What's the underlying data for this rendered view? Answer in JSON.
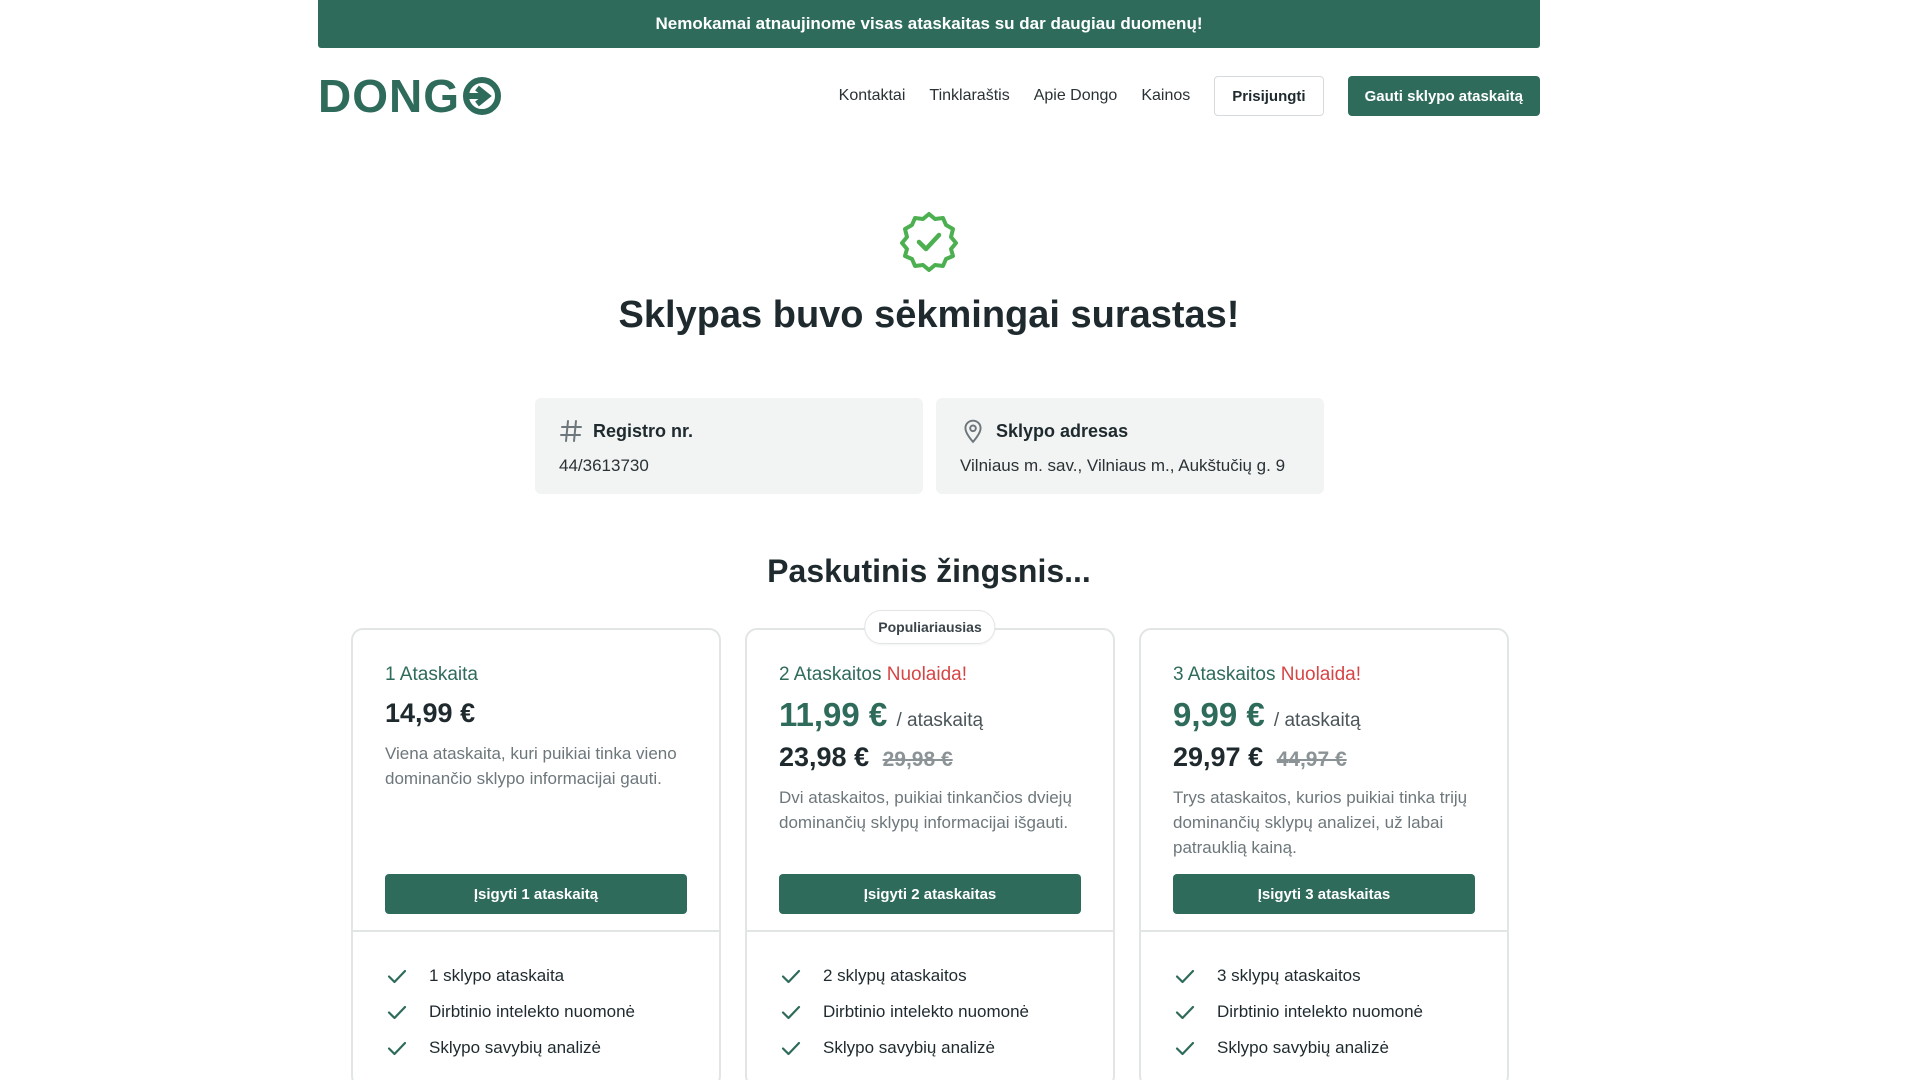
{
  "banner": {
    "text": "Nemokamai atnaujinome visas ataskaitas su dar daugiau duomenų!"
  },
  "header": {
    "logo_text": "DONG",
    "nav": [
      "Kontaktai",
      "Tinklaraštis",
      "Apie Dongo",
      "Kainos"
    ],
    "login_label": "Prisijungti",
    "cta_label": "Gauti sklypo ataskaitą"
  },
  "result": {
    "title": "Sklypas buvo sėkmingai surastas!",
    "registry": {
      "label": "Registro nr.",
      "value": "44/3613730"
    },
    "address": {
      "label": "Sklypo adresas",
      "value": "Vilniaus m. sav., Vilniaus m., Aukštučių g. 9"
    }
  },
  "pricing": {
    "title": "Paskutinis žingsnis...",
    "popular_badge": "Populiariausias",
    "plans": [
      {
        "name": "1 Ataskaita",
        "promo": "",
        "price": "14,99 €",
        "description": "Viena ataskaita, kuri puikiai tinka vieno dominančio sklypo informacijai gauti.",
        "button": "Įsigyti 1 ataskaitą",
        "features": [
          "1 sklypo ataskaita",
          "Dirbtinio intelekto nuomonė",
          "Sklypo savybių analizė"
        ]
      },
      {
        "name": "2 Ataskaitos",
        "promo": "Nuolaida!",
        "unit_price": "11,99 €",
        "per": "/ ataskaitą",
        "total": "23,98 €",
        "old_total": "29,98 €",
        "description": "Dvi ataskaitos, puikiai tinkančios dviejų dominančių sklypų informacijai išgauti.",
        "button": "Įsigyti 2 ataskaitas",
        "features": [
          "2 sklypų ataskaitos",
          "Dirbtinio intelekto nuomonė",
          "Sklypo savybių analizė"
        ]
      },
      {
        "name": "3 Ataskaitos",
        "promo": "Nuolaida!",
        "unit_price": "9,99 €",
        "per": "/ ataskaitą",
        "total": "29,97 €",
        "old_total": "44,97 €",
        "description": "Trys ataskaitos, kurios puikiai tinka trijų dominančių sklypų analizei, už labai patrauklią kainą.",
        "button": "Įsigyti 3 ataskaitas",
        "features": [
          "3 sklypų ataskaitos",
          "Dirbtinio intelekto nuomonė",
          "Sklypo savybių analizė"
        ]
      }
    ]
  },
  "colors": {
    "brand": "#2e6b5b",
    "promo": "#d64545",
    "success": "#4caf50"
  }
}
